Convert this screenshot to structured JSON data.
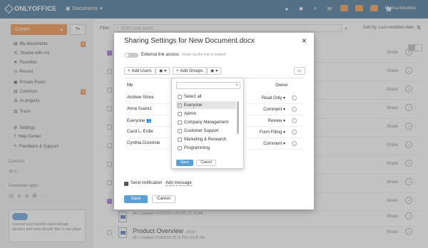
{
  "topbar": {
    "brand": "ONLYOFFICE",
    "module": "Documents",
    "user": "Marina Kendrick"
  },
  "sidebar": {
    "create_label": "Create",
    "items": [
      {
        "label": "My documents",
        "badge": "3"
      },
      {
        "label": "Shared with me"
      },
      {
        "label": "Favorites"
      },
      {
        "label": "Recent"
      },
      {
        "label": "Private Room"
      },
      {
        "label": "Common",
        "badge": "3"
      },
      {
        "label": "In projects"
      },
      {
        "label": "Trash"
      },
      {
        "label": "Settings"
      },
      {
        "label": "Help Center"
      },
      {
        "label": "Feedback & Support"
      }
    ],
    "connect_title": "Connect",
    "apps_title": "Download apps",
    "promo_text": "Connect your favorite cloud storage services and store all your files in one place"
  },
  "main": {
    "filter_label": "Filter:",
    "filter_placeholder": "Enter your query",
    "sort_label": "Sort by: Last modified date",
    "share_label": "Share",
    "doc1_sub": "Me | Updated 2/17/2020 6:25 PM | 21.15 KB",
    "doc2_name": "Product Overview",
    "doc2_ext": ".docx",
    "doc2_sub": "Me | Updated 3/18/2019 12:15 PM | 13.41 KB"
  },
  "dialog": {
    "title": "Sharing Settings for New Document.docx",
    "close": "×",
    "ext_label": "External link access",
    "ext_desc": "Share via the link or embed",
    "add_users": "Add Users",
    "add_groups": "Add Groups",
    "col_me": "Me",
    "col_owner": "Owner",
    "users": [
      {
        "name": "Andrew Stone",
        "access": "Read Only"
      },
      {
        "name": "Anna Suarez",
        "access": "Comment"
      },
      {
        "name": "Everyone",
        "access": "Review"
      },
      {
        "name": "Carol L. Erdle",
        "access": "Form Filling"
      },
      {
        "name": "Cynthia Donohue",
        "access": "Comment"
      }
    ],
    "notify_label": "Send notification",
    "add_message": "Add message",
    "save": "Save",
    "cancel": "Cancel"
  },
  "groups_dropdown": {
    "items": [
      {
        "label": "Select all",
        "checked": false
      },
      {
        "label": "Everyone",
        "checked": true
      },
      {
        "label": "Admin",
        "checked": false
      },
      {
        "label": "Company Management",
        "checked": false
      },
      {
        "label": "Customer Support",
        "checked": false
      },
      {
        "label": "Marketing & Research",
        "checked": false
      },
      {
        "label": "Programming",
        "checked": false
      }
    ],
    "save": "Save",
    "cancel": "Cancel"
  },
  "colors": {
    "topbar": "#3a6b91",
    "accent_orange": "#ef8a3f",
    "primary_blue": "#5c9fd6"
  }
}
